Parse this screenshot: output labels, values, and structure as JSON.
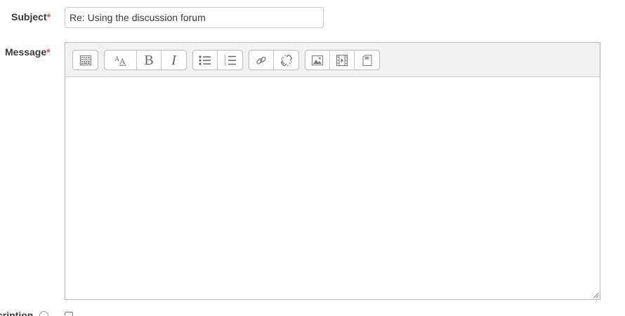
{
  "form": {
    "subject": {
      "label": "Subject",
      "required_marker": "*",
      "value": "Re: Using the discussion forum"
    },
    "message": {
      "label": "Message",
      "required_marker": "*",
      "content": ""
    },
    "next_field": {
      "label_partial": "cription",
      "checked": true
    }
  },
  "toolbar": {
    "groups": [
      [
        "toolbar-toggle-icon"
      ],
      [
        "font-size-icon",
        "bold-icon",
        "italic-icon"
      ],
      [
        "unordered-list-icon",
        "ordered-list-icon"
      ],
      [
        "link-icon",
        "unlink-icon"
      ],
      [
        "image-icon",
        "media-icon",
        "manage-files-icon"
      ]
    ],
    "bold_glyph": "B",
    "italic_glyph": "I"
  },
  "colors": {
    "required": "#d9534f",
    "toolbar_bg": "#f2f2f2",
    "border": "#b8b8b8",
    "text": "#373a3c"
  }
}
